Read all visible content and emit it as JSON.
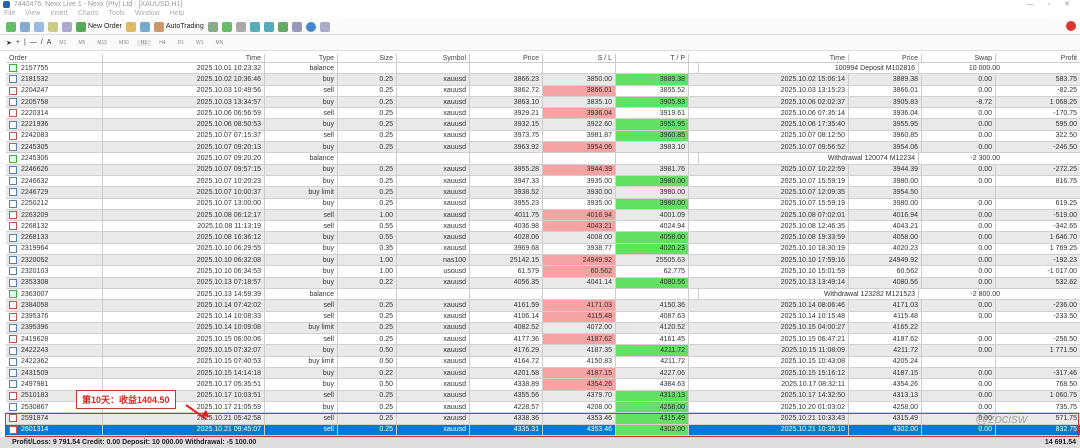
{
  "window": {
    "title": "7440476: Nexx Live 1 - Nexx (Pty) Ltd - [XAUUSD,H1]"
  },
  "menu": [
    "File",
    "View",
    "Insert",
    "Charts",
    "Tools",
    "Window",
    "Help"
  ],
  "toolbar": {
    "new_order": "New Order",
    "autotrading": "AutoTrading",
    "timeframes": [
      "M1",
      "M5",
      "M15",
      "M30",
      "H1",
      "H4",
      "D1",
      "W1",
      "MN"
    ]
  },
  "columns": [
    "Order",
    "Time",
    "Type",
    "Size",
    "Symbol",
    "Price",
    "S / L",
    "T / P",
    "Time",
    "Price",
    "Swap",
    "Profit"
  ],
  "rows": [
    [
      "2157755",
      "2025.10.01 10:23:32",
      "balance",
      "",
      "",
      "",
      "",
      "",
      "",
      "100994 Deposit M102816",
      "",
      "10 000.00",
      ""
    ],
    [
      "2181532",
      "2025.10.02 10:36:46",
      "buy",
      "0.25",
      "xauusd",
      "3866.23",
      "3850.00",
      "3889.38",
      "2025.10.02 15:06:14",
      "3889.38",
      "0.00",
      "583.75",
      "tp"
    ],
    [
      "2204247",
      "2025.10.03 10:49:56",
      "sell",
      "0.25",
      "xauusd",
      "3862.72",
      "3866.01",
      "3855.52",
      "2025.10.03 13:15:23",
      "3866.01",
      "0.00",
      "-82.25",
      "sl"
    ],
    [
      "2205758",
      "2025.10.03 13:34:57",
      "buy",
      "0.25",
      "xauusd",
      "3863.10",
      "3835.10",
      "3905.83",
      "2025.10.06 02:02:37",
      "3905.83",
      "-8.72",
      "1 068.25",
      "tp"
    ],
    [
      "2220314",
      "2025.10.06 06:56:59",
      "sell",
      "0.25",
      "xauusd",
      "3929.21",
      "3936.04",
      "3919.61",
      "2025.10.06 07:35:14",
      "3936.04",
      "0.00",
      "-170.75",
      "sl"
    ],
    [
      "2221936",
      "2025.10.06 08:50:53",
      "buy",
      "0.25",
      "xauusd",
      "3932.15",
      "3922.60",
      "3955.95",
      "2025.10.06 17:35:40",
      "3955.95",
      "0.00",
      "595.00",
      "tp"
    ],
    [
      "2242083",
      "2025.10.07 07:15:37",
      "sell",
      "0.25",
      "xauusd",
      "3973.75",
      "3981.87",
      "3960.85",
      "2025.10.07 08:12:50",
      "3960.85",
      "0.00",
      "322.50",
      "tp"
    ],
    [
      "2245305",
      "2025.10.07 09:20:13",
      "buy",
      "0.25",
      "xauusd",
      "3963.92",
      "3954.06",
      "3983.10",
      "2025.10.07 09:56:52",
      "3954.06",
      "0.00",
      "-246.50",
      "sl"
    ],
    [
      "2245306",
      "2025.10.07 09:20:20",
      "balance",
      "",
      "",
      "",
      "",
      "",
      "",
      "Withdrawal 120074 M12234",
      "",
      "-2 300.00",
      ""
    ],
    [
      "2246626",
      "2025.10.07 09:57:15",
      "buy",
      "0.25",
      "xauusd",
      "3955.28",
      "3944.39",
      "3981.76",
      "2025.10.07 10:22:59",
      "3944.39",
      "0.00",
      "-272.25",
      "sl"
    ],
    [
      "2246632",
      "2025.10.07 10:20:23",
      "buy",
      "0.25",
      "xauusd",
      "3947.33",
      "3935.00",
      "3980.00",
      "2025.10.07 15:59:19",
      "3980.00",
      "0.00",
      "816.75",
      "tp"
    ],
    [
      "2246729",
      "2025.10.07 10:00:37",
      "buy limit",
      "0.25",
      "xauusd",
      "3938.52",
      "3930.00",
      "3980.00",
      "2025.10.07 12:09:35",
      "3954.50",
      "",
      "",
      ""
    ],
    [
      "2250212",
      "2025.10.07 13:00:00",
      "buy",
      "0.25",
      "xauusd",
      "3955.23",
      "3935.00",
      "3980.00",
      "2025.10.07 15:59:19",
      "3980.00",
      "0.00",
      "619.25",
      "tp"
    ],
    [
      "2263209",
      "2025.10.08 06:12:17",
      "sell",
      "1.00",
      "xauusd",
      "4011.75",
      "4016.94",
      "4001.09",
      "2025.10.08 07:02:01",
      "4016.94",
      "0.00",
      "-519.00",
      "sl"
    ],
    [
      "2268132",
      "2025.10.08 11:13:19",
      "sell",
      "0.55",
      "xauusd",
      "4036.98",
      "4043.21",
      "4024.94",
      "2025.10.08 12:46:35",
      "4043.21",
      "0.00",
      "-342.65",
      "sl"
    ],
    [
      "2268133",
      "2025.10.08 16:36:12",
      "buy",
      "0.55",
      "xauusd",
      "4028.06",
      "4008.00",
      "4058.00",
      "2025.10.08 19:33:59",
      "4058.00",
      "0.00",
      "1 646.70",
      "tp"
    ],
    [
      "2319964",
      "2025.10.10 06:29:55",
      "buy",
      "0.35",
      "xauusd",
      "3969.68",
      "3938.77",
      "4020.23",
      "2025.10.10 18:30:19",
      "4020.23",
      "0.00",
      "1 769.25",
      "tp"
    ],
    [
      "2320052",
      "2025.10.10 06:32:08",
      "buy",
      "1.00",
      "nas100",
      "25142.15",
      "24949.92",
      "25505.63",
      "2025.10.10 17:59:16",
      "24949.92",
      "0.00",
      "-192.23",
      "sl"
    ],
    [
      "2320103",
      "2025.10.10 06:34:53",
      "buy",
      "1.00",
      "usousd",
      "61.579",
      "60.562",
      "62.775",
      "2025.10.10 15:01:59",
      "60.562",
      "0.00",
      "-1 017.00",
      "sl"
    ],
    [
      "2353308",
      "2025.10.13 07:18:57",
      "buy",
      "0.22",
      "xauusd",
      "4056.35",
      "4041.14",
      "4080.56",
      "2025.10.13 13:49:14",
      "4080.56",
      "0.00",
      "532.62",
      "tp"
    ],
    [
      "2363007",
      "2025.10.13 14:59:39",
      "balance",
      "",
      "",
      "",
      "",
      "",
      "",
      "Withdrawal 123282 M121523",
      "",
      "-2 800.00",
      ""
    ],
    [
      "2384058",
      "2025.10.14 07:42:02",
      "sell",
      "0.25",
      "xauusd",
      "4161.59",
      "4171.03",
      "4150.36",
      "2025.10.14 08:06:46",
      "4171.03",
      "0.00",
      "-236.00",
      "sl"
    ],
    [
      "2395376",
      "2025.10.14 10:08:33",
      "sell",
      "0.25",
      "xauusd",
      "4106.14",
      "4115.48",
      "4087.63",
      "2025.10.14 10:15:48",
      "4115.48",
      "0.00",
      "-233.50",
      "sl"
    ],
    [
      "2395396",
      "2025.10.14 10:09:08",
      "buy limit",
      "0.25",
      "xauusd",
      "4082.52",
      "4072.00",
      "4120.52",
      "2025.10.15 04:00:27",
      "4165.22",
      "",
      "",
      ""
    ],
    [
      "2419628",
      "2025.10.15 06:00:06",
      "sell",
      "0.25",
      "xauusd",
      "4177.36",
      "4187.62",
      "4161.45",
      "2025.10.15 06:47:21",
      "4187.62",
      "0.00",
      "-256.50",
      "sl"
    ],
    [
      "2422243",
      "2025.10.15 07:32:07",
      "buy",
      "0.50",
      "xauusd",
      "4176.29",
      "4187.35",
      "4211.72",
      "2025.10.15 11:08:09",
      "4211.72",
      "0.00",
      "1 771.50",
      "tp"
    ],
    [
      "2422362",
      "2025.10.15 07:40:53",
      "buy limit",
      "0.50",
      "xauusd",
      "4164.72",
      "4150.83",
      "4211.72",
      "2025.10.15 10:43:08",
      "4205.24",
      "",
      "",
      ""
    ],
    [
      "2431509",
      "2025.10.15 14:14:18",
      "buy",
      "0.22",
      "xauusd",
      "4201.58",
      "4187.15",
      "4227.06",
      "2025.10.15 15:16:12",
      "4187.15",
      "0.00",
      "-317.46",
      "sl"
    ],
    [
      "2497981",
      "2025.10.17 05:35:51",
      "buy",
      "0.50",
      "xauusd",
      "4338.89",
      "4354.26",
      "4384.63",
      "2025.10.17 08:32:11",
      "4354.26",
      "0.00",
      "768.50",
      "sl"
    ],
    [
      "2510183",
      "2025.10.17 10:03:51",
      "sell",
      "0.25",
      "xauusd",
      "4355.56",
      "4379.70",
      "4313.13",
      "2025.10.17 14:32:50",
      "4313.13",
      "0.00",
      "1 060.75",
      "tp"
    ],
    [
      "2530867",
      "2025.10.17 21:05:59",
      "buy",
      "0.25",
      "xauusd",
      "4228.57",
      "4208.00",
      "4258.00",
      "2025.10.20 01:03:02",
      "4258.00",
      "0.00",
      "735.75",
      "tp"
    ],
    [
      "2591874",
      "2025.10.21 05:42:58",
      "sell",
      "0.25",
      "xauusd",
      "4338.36",
      "4353.46",
      "4315.49",
      "2025.10.21 10:33:43",
      "4315.49",
      "0.00",
      "571.75",
      "tp"
    ],
    [
      "2601314",
      "2025.10.21 09:45:07",
      "sell",
      "0.25",
      "xauusd",
      "4335.31",
      "4353.46",
      "4302.00",
      "2025.10.21 10:35:10",
      "4302.00",
      "0.00",
      "832.75",
      "tp"
    ]
  ],
  "selected_order": "2601314",
  "footer": {
    "summary": "Profit/Loss: 9 791.54  Credit: 0.00  Deposit: 10 000.00  Withdrawal: -5 100.00",
    "total": "14 691.54"
  },
  "annotation": "第10天：收益1404.50",
  "watermark": "@zocisw",
  "colors": {
    "sl_hit": "#f5a3a3",
    "tp_hit": "#62e062",
    "selected": "#0078d7",
    "annotation": "#d22222"
  }
}
